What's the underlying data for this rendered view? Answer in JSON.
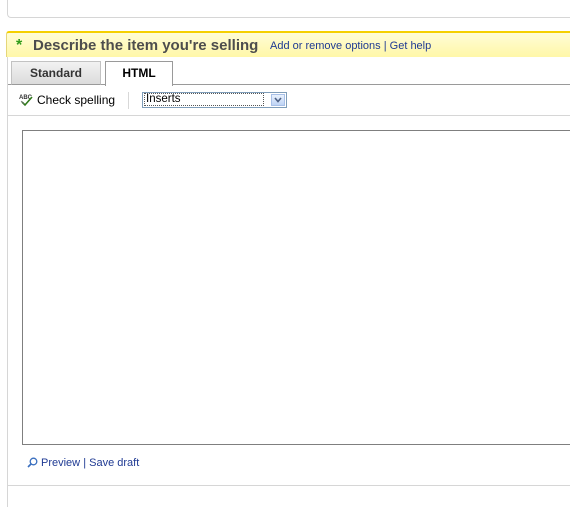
{
  "section": {
    "required_marker": "*",
    "title": "Describe the item you're selling",
    "links": [
      {
        "label": "Add or remove options"
      },
      {
        "label": "Get help"
      }
    ],
    "separator": "|"
  },
  "tabs": [
    {
      "label": "Standard",
      "active": false
    },
    {
      "label": "HTML",
      "active": true
    }
  ],
  "toolbar": {
    "spell_check_label": "Check spelling",
    "spell_check_icon": "abc-spellcheck-icon",
    "inserts_select_value": "Inserts"
  },
  "editor": {
    "content": ""
  },
  "footer": {
    "preview_icon": "magnifier-icon",
    "preview_label": "Preview",
    "separator": "|",
    "save_draft_label": "Save draft"
  },
  "colors": {
    "accent_green": "#2f9b1a",
    "header_yellow": "#fff7a8",
    "header_border": "#f5d000",
    "link_blue": "#1f3a93"
  }
}
